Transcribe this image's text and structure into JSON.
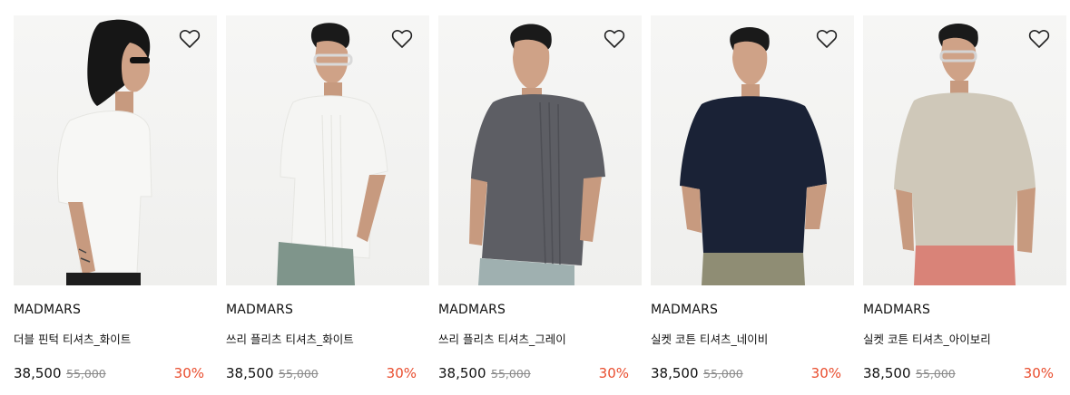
{
  "products": [
    {
      "brand": "MADMARS",
      "name": "더블 핀턱 티셔츠_화이트",
      "price": "38,500",
      "original_price": "55,000",
      "discount": "30%",
      "shirt_color": "#f7f7f5",
      "pants_color": "#1d1d1d",
      "image_desc": "side-profile-model-sunglasses"
    },
    {
      "brand": "MADMARS",
      "name": "쓰리 플리츠 티셔츠_화이트",
      "price": "38,500",
      "original_price": "55,000",
      "discount": "30%",
      "shirt_color": "#f5f5f3",
      "pants_color": "#7f958b",
      "image_desc": "model-leaning-glasses"
    },
    {
      "brand": "MADMARS",
      "name": "쓰리 플리츠 티셔츠_그레이",
      "price": "38,500",
      "original_price": "55,000",
      "discount": "30%",
      "shirt_color": "#5d5e64",
      "pants_color": "#9fb0b0",
      "image_desc": "model-looking-down"
    },
    {
      "brand": "MADMARS",
      "name": "실켓 코튼 티셔츠_네이비",
      "price": "38,500",
      "original_price": "55,000",
      "discount": "30%",
      "shirt_color": "#1a2236",
      "pants_color": "#8f8d74",
      "image_desc": "model-front-navy"
    },
    {
      "brand": "MADMARS",
      "name": "실켓 코튼 티셔츠_아이보리",
      "price": "38,500",
      "original_price": "55,000",
      "discount": "30%",
      "shirt_color": "#cfc8b9",
      "pants_color": "#d98378",
      "image_desc": "model-front-ivory-glasses"
    }
  ],
  "colors": {
    "discount": "#e94d2e",
    "original_price": "#8a8a8a"
  },
  "icons": {
    "wishlist": "heart-outline-icon"
  }
}
